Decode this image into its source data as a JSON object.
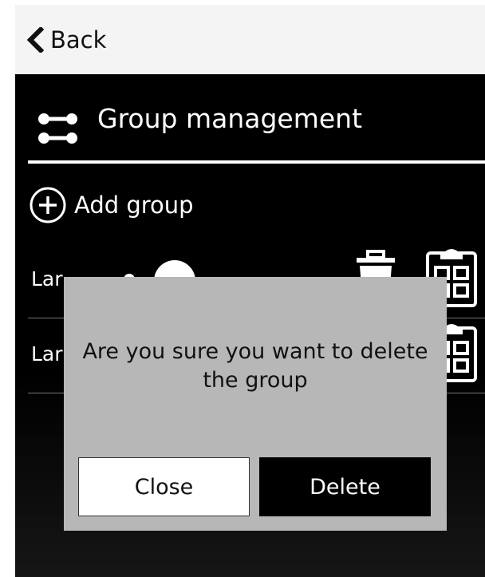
{
  "topbar": {
    "back_label": "Back"
  },
  "header": {
    "title": "Group management"
  },
  "add_group_label": "Add group",
  "groups": [
    {
      "name": "Lar"
    },
    {
      "name": "Lar"
    }
  ],
  "dialog": {
    "message": "Are you sure you want to delete the group",
    "close_label": "Close",
    "delete_label": "Delete"
  },
  "icons": {
    "back": "chevron-left-icon",
    "group": "group-icon",
    "add": "plus-circle-icon",
    "trash": "trash-icon",
    "clipboard": "clipboard-icon"
  },
  "colors": {
    "screen_bg": "#000000",
    "dialog_bg": "#b7b7b7",
    "delete_button_bg": "#000000",
    "close_button_bg": "#ffffff"
  }
}
